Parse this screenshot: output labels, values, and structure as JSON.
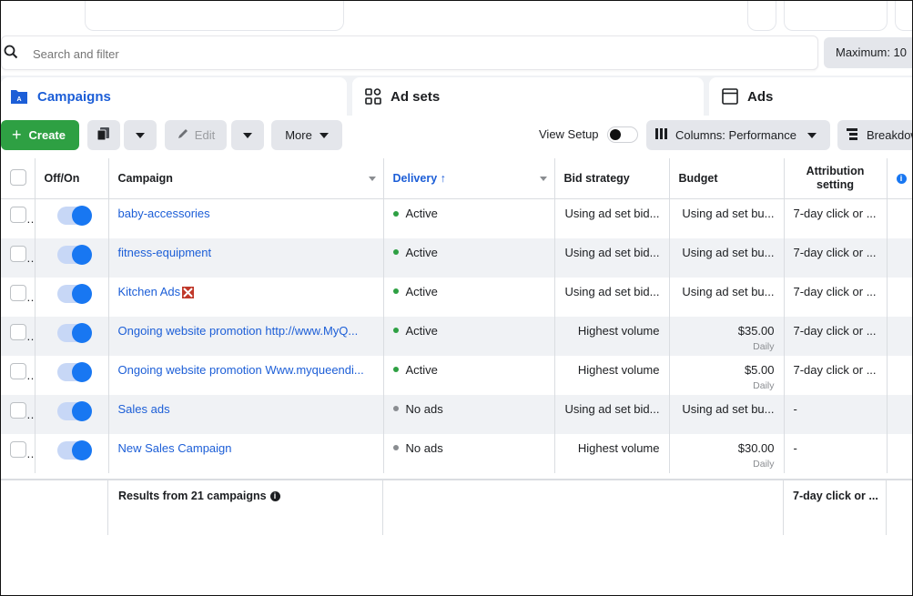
{
  "search": {
    "placeholder": "Search and filter",
    "maximum_label": "Maximum: 10"
  },
  "tabs": [
    {
      "label": "Campaigns",
      "active": true
    },
    {
      "label": "Ad sets",
      "active": false
    },
    {
      "label": "Ads",
      "active": false
    }
  ],
  "toolbar": {
    "create_label": "Create",
    "edit_label": "Edit",
    "more_label": "More",
    "view_setup_label": "View Setup",
    "columns_label": "Columns: Performance",
    "breakdown_label": "Breakdown"
  },
  "table": {
    "headers": {
      "off_on": "Off/On",
      "campaign": "Campaign",
      "delivery": "Delivery ↑",
      "bid_strategy": "Bid strategy",
      "budget": "Budget",
      "attribution": "Attribution setting"
    },
    "rows": [
      {
        "campaign": "baby-accessories",
        "delivery": "Active",
        "bid": "Using ad set bid...",
        "budget": "Using ad set bu...",
        "budget_period": "",
        "attribution": "7-day click or ..."
      },
      {
        "campaign": "fitness-equipment",
        "delivery": "Active",
        "bid": "Using ad set bid...",
        "budget": "Using ad set bu...",
        "budget_period": "",
        "attribution": "7-day click or ..."
      },
      {
        "campaign": "Kitchen Ads",
        "delivery": "Active",
        "bid": "Using ad set bid...",
        "budget": "Using ad set bu...",
        "budget_period": "",
        "attribution": "7-day click or ..."
      },
      {
        "campaign": "Ongoing website promotion http://www.MyQ...",
        "delivery": "Active",
        "bid": "Highest volume",
        "budget": "$35.00",
        "budget_period": "Daily",
        "attribution": "7-day click or ..."
      },
      {
        "campaign": "Ongoing website promotion Www.myqueendi...",
        "delivery": "Active",
        "bid": "Highest volume",
        "budget": "$5.00",
        "budget_period": "Daily",
        "attribution": "7-day click or ..."
      },
      {
        "campaign": "Sales ads",
        "delivery": "No ads",
        "bid": "Using ad set bid...",
        "budget": "Using ad set bu...",
        "budget_period": "",
        "attribution": "-"
      },
      {
        "campaign": "New Sales Campaign",
        "delivery": "No ads",
        "bid": "Highest volume",
        "budget": "$30.00",
        "budget_period": "Daily",
        "attribution": "-"
      }
    ],
    "footer": {
      "results": "Results from 21 campaigns",
      "attribution": "7-day click or ..."
    }
  },
  "colors": {
    "accent": "#1877f2",
    "active_dot": "#2ea043",
    "inactive_dot": "#8a8d91",
    "create_button": "#2ea043"
  }
}
